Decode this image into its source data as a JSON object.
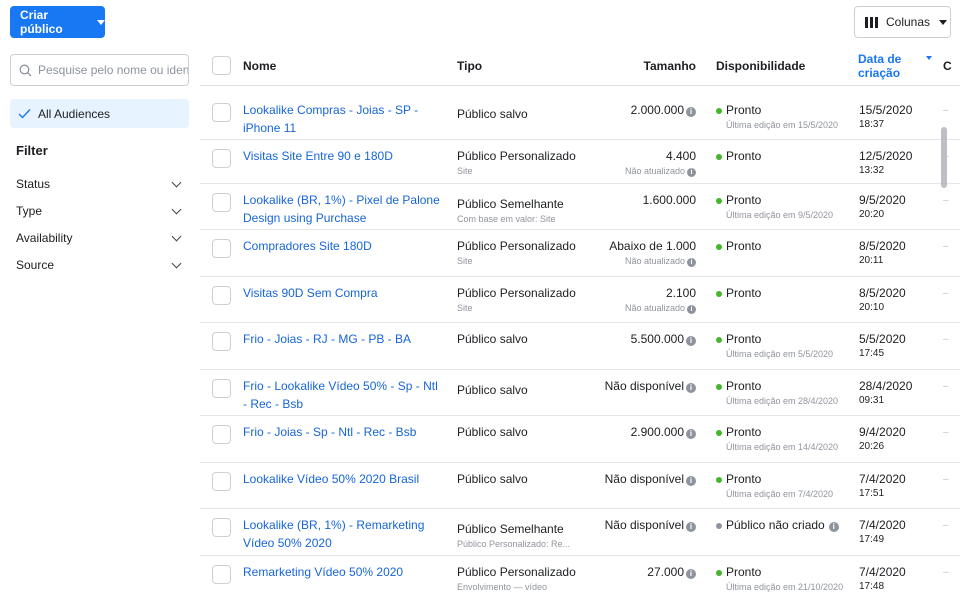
{
  "toolbar": {
    "create_label": "Criar público",
    "columns_label": "Colunas"
  },
  "sidebar": {
    "search_placeholder": "Pesquise pelo nome ou identifi...",
    "all_audiences": "All Audiences",
    "filter_title": "Filter",
    "filters": [
      "Status",
      "Type",
      "Availability",
      "Source"
    ]
  },
  "table": {
    "headers": {
      "name": "Nome",
      "type": "Tipo",
      "size": "Tamanho",
      "availability": "Disponibilidade",
      "date": "Data de criação",
      "extra": "C"
    },
    "rows": [
      {
        "name": "Lookalike Compras - Joias - SP - iPhone 11",
        "type": "Público salvo",
        "type_sub": "",
        "size": "2.000.000",
        "size_info": true,
        "size_sub": "",
        "status": "Pronto",
        "status_color": "#42b72a",
        "status_info": false,
        "status_sub": "Última edição em 15/5/2020",
        "date": "15/5/2020",
        "time": "18:37",
        "extra": "–"
      },
      {
        "name": "Visitas Site Entre 90 e 180D",
        "type": "Público Personalizado",
        "type_sub": "Site",
        "size": "4.400",
        "size_info": false,
        "size_sub": "Não atualizado",
        "status": "Pronto",
        "status_color": "#42b72a",
        "status_info": false,
        "status_sub": "",
        "date": "12/5/2020",
        "time": "13:32",
        "extra": "–"
      },
      {
        "name": "Lookalike (BR, 1%) - Pixel de Palone Design using Purchase",
        "type": "Público Semelhante",
        "type_sub": "Com base em valor: Site",
        "size": "1.600.000",
        "size_info": false,
        "size_sub": "",
        "status": "Pronto",
        "status_color": "#42b72a",
        "status_info": false,
        "status_sub": "Última edição em 9/5/2020",
        "date": "9/5/2020",
        "time": "20:20",
        "extra": "–"
      },
      {
        "name": "Compradores Site 180D",
        "type": "Público Personalizado",
        "type_sub": "Site",
        "size": "Abaixo de 1.000",
        "size_info": false,
        "size_sub": "Não atualizado",
        "status": "Pronto",
        "status_color": "#42b72a",
        "status_info": false,
        "status_sub": "",
        "date": "8/5/2020",
        "time": "20:11",
        "extra": "–"
      },
      {
        "name": "Visitas 90D Sem Compra",
        "type": "Público Personalizado",
        "type_sub": "Site",
        "size": "2.100",
        "size_info": false,
        "size_sub": "Não atualizado",
        "status": "Pronto",
        "status_color": "#42b72a",
        "status_info": false,
        "status_sub": "",
        "date": "8/5/2020",
        "time": "20:10",
        "extra": "–"
      },
      {
        "name": "Frio - Joias - RJ - MG - PB - BA",
        "type": "Público salvo",
        "type_sub": "",
        "size": "5.500.000",
        "size_info": true,
        "size_sub": "",
        "status": "Pronto",
        "status_color": "#42b72a",
        "status_info": false,
        "status_sub": "Última edição em 5/5/2020",
        "date": "5/5/2020",
        "time": "17:45",
        "extra": "–"
      },
      {
        "name": "Frio - Lookalike Vídeo 50% - Sp - Ntl - Rec - Bsb",
        "type": "Público salvo",
        "type_sub": "",
        "size": "Não disponível",
        "size_info": true,
        "size_sub": "",
        "status": "Pronto",
        "status_color": "#42b72a",
        "status_info": false,
        "status_sub": "Última edição em 28/4/2020",
        "date": "28/4/2020",
        "time": "09:31",
        "extra": "–"
      },
      {
        "name": "Frio - Joias - Sp - Ntl - Rec - Bsb",
        "type": "Público salvo",
        "type_sub": "",
        "size": "2.900.000",
        "size_info": true,
        "size_sub": "",
        "status": "Pronto",
        "status_color": "#42b72a",
        "status_info": false,
        "status_sub": "Última edição em 14/4/2020",
        "date": "9/4/2020",
        "time": "20:26",
        "extra": "–"
      },
      {
        "name": "Lookalike Vídeo 50% 2020 Brasil",
        "type": "Público salvo",
        "type_sub": "",
        "size": "Não disponível",
        "size_info": true,
        "size_sub": "",
        "status": "Pronto",
        "status_color": "#42b72a",
        "status_info": false,
        "status_sub": "Última edição em 7/4/2020",
        "date": "7/4/2020",
        "time": "17:51",
        "extra": "–"
      },
      {
        "name": "Lookalike (BR, 1%) - Remarketing Vídeo 50% 2020",
        "type": "Público Semelhante",
        "type_sub": "Público Personalizado: Re...",
        "size": "Não disponível",
        "size_info": true,
        "size_sub": "",
        "status": "Público não criado",
        "status_color": "#8d949e",
        "status_info": true,
        "status_sub": "",
        "date": "7/4/2020",
        "time": "17:49",
        "extra": "–"
      },
      {
        "name": "Remarketing Vídeo 50% 2020",
        "type": "Público Personalizado",
        "type_sub": "Envolvimento — vídeo",
        "size": "27.000",
        "size_info": true,
        "size_sub": "",
        "status": "Pronto",
        "status_color": "#42b72a",
        "status_info": false,
        "status_sub": "Última edição em 21/10/2020",
        "date": "7/4/2020",
        "time": "17:48",
        "extra": "–"
      }
    ]
  },
  "icons": {
    "search": "search-icon",
    "check": "check-icon",
    "columns": "columns-icon",
    "info": "info-icon",
    "chevron": "chevron-down-icon"
  }
}
